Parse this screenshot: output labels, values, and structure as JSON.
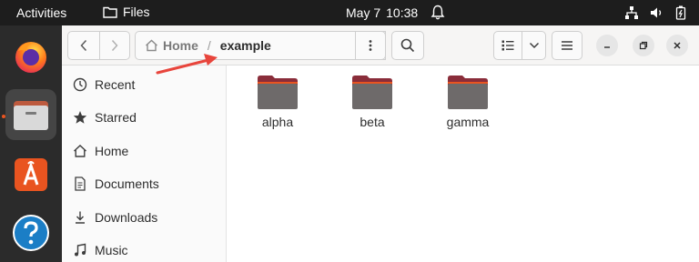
{
  "topbar": {
    "activities": "Activities",
    "app_name": "Files",
    "date": "May 7",
    "time": "10:38"
  },
  "dock": {
    "items": [
      {
        "name": "firefox",
        "icon": "firefox-icon"
      },
      {
        "name": "files",
        "icon": "files-icon",
        "active": true
      },
      {
        "name": "app-center",
        "icon": "app-center-icon"
      },
      {
        "name": "help",
        "icon": "help-icon"
      }
    ]
  },
  "pathbar": {
    "home_label": "Home",
    "separator": "/",
    "current_label": "example"
  },
  "sidebar": {
    "items": [
      {
        "label": "Recent",
        "icon": "clock-icon"
      },
      {
        "label": "Starred",
        "icon": "star-icon"
      },
      {
        "label": "Home",
        "icon": "home-icon"
      },
      {
        "label": "Documents",
        "icon": "document-icon"
      },
      {
        "label": "Downloads",
        "icon": "download-icon"
      },
      {
        "label": "Music",
        "icon": "music-icon"
      }
    ]
  },
  "files": [
    {
      "label": "alpha"
    },
    {
      "label": "beta"
    },
    {
      "label": "gamma"
    }
  ],
  "colors": {
    "topbar_bg": "#1d1d1d",
    "dock_bg": "#2b2b2b",
    "accent": "#e95420",
    "folder_body": "#6e6a6a",
    "folder_tab": "#8a2d3a",
    "annotation_arrow": "#e8453c"
  }
}
